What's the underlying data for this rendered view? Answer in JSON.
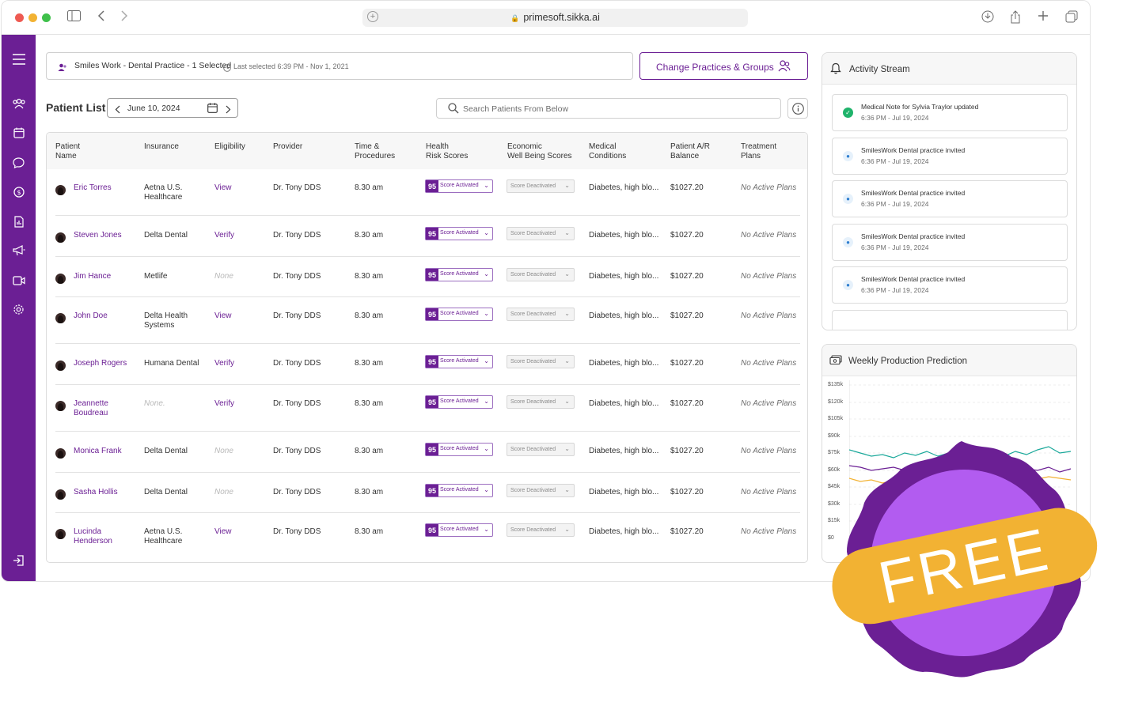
{
  "browser": {
    "url": "primesoft.sikka.ai"
  },
  "practice": {
    "name": "Smiles Work - Dental Practice - 1 Selected",
    "last_selected": "Last selected 6:39 PM - Nov 1, 2021",
    "change_button": "Change Practices & Groups"
  },
  "patient_list": {
    "title": "Patient List",
    "date": "June 10, 2024",
    "search_placeholder": "Search Patients From Below"
  },
  "table": {
    "headers": [
      {
        "line1": "Patient",
        "line2": "Name"
      },
      {
        "line1": "Insurance",
        "line2": ""
      },
      {
        "line1": "Eligibility",
        "line2": ""
      },
      {
        "line1": "Provider",
        "line2": ""
      },
      {
        "line1": "Time &",
        "line2": "Procedures"
      },
      {
        "line1": "Health",
        "line2": "Risk Scores"
      },
      {
        "line1": "Economic",
        "line2": "Well Being Scores"
      },
      {
        "line1": "Medical",
        "line2": "Conditions"
      },
      {
        "line1": "Patient A/R",
        "line2": "Balance"
      },
      {
        "line1": "Treatment",
        "line2": "Plans"
      }
    ],
    "rows": [
      {
        "name1": "Eric Torres",
        "name2": "",
        "ins1": "Aetna U.S.",
        "ins2": "Healthcare",
        "elig": "View",
        "provider": "Dr. Tony DDS",
        "time": "8.30 am",
        "score": "95",
        "score_label": "Score Activated",
        "econ": "Score Deactivated",
        "cond": "Diabetes, high blo...",
        "balance": "$1027.20",
        "plans": "No Active Plans"
      },
      {
        "name1": "Steven Jones",
        "name2": "",
        "ins1": "Delta Dental",
        "ins2": "",
        "elig": "Verify",
        "provider": "Dr. Tony DDS",
        "time": "8.30 am",
        "score": "95",
        "score_label": "Score Activated",
        "econ": "Score Deactivated",
        "cond": "Diabetes, high blo...",
        "balance": "$1027.20",
        "plans": "No Active Plans"
      },
      {
        "name1": "Jim Hance",
        "name2": "",
        "ins1": "Metlife",
        "ins2": "",
        "elig": "None",
        "provider": "Dr. Tony DDS",
        "time": "8.30 am",
        "score": "95",
        "score_label": "Score Activated",
        "econ": "Score Deactivated",
        "cond": "Diabetes, high blo...",
        "balance": "$1027.20",
        "plans": "No Active Plans"
      },
      {
        "name1": "John Doe",
        "name2": "",
        "ins1": "Delta Health",
        "ins2": "Systems",
        "elig": "View",
        "provider": "Dr. Tony DDS",
        "time": "8.30 am",
        "score": "95",
        "score_label": "Score Activated",
        "econ": "Score Deactivated",
        "cond": "Diabetes, high blo...",
        "balance": "$1027.20",
        "plans": "No Active Plans"
      },
      {
        "name1": "Joseph Rogers",
        "name2": "",
        "ins1": "Humana Dental",
        "ins2": "",
        "elig": "Verify",
        "provider": "Dr. Tony DDS",
        "time": "8.30 am",
        "score": "95",
        "score_label": "Score Activated",
        "econ": "Score Deactivated",
        "cond": "Diabetes, high blo...",
        "balance": "$1027.20",
        "plans": "No Active Plans"
      },
      {
        "name1": "Jeannette",
        "name2": "Boudreau",
        "ins1": "None.",
        "ins2": "",
        "elig": "Verify",
        "provider": "Dr. Tony DDS",
        "time": "8.30 am",
        "score": "95",
        "score_label": "Score Activated",
        "econ": "Score Deactivated",
        "cond": "Diabetes, high blo...",
        "balance": "$1027.20",
        "plans": "No Active Plans"
      },
      {
        "name1": "Monica Frank",
        "name2": "",
        "ins1": "Delta Dental",
        "ins2": "",
        "elig": "None",
        "provider": "Dr. Tony DDS",
        "time": "8.30 am",
        "score": "95",
        "score_label": "Score Activated",
        "econ": "Score Deactivated",
        "cond": "Diabetes, high blo...",
        "balance": "$1027.20",
        "plans": "No Active Plans"
      },
      {
        "name1": "Sasha Hollis",
        "name2": "",
        "ins1": "Delta Dental",
        "ins2": "",
        "elig": "None",
        "provider": "Dr. Tony DDS",
        "time": "8.30 am",
        "score": "95",
        "score_label": "Score Activated",
        "econ": "Score Deactivated",
        "cond": "Diabetes, high blo...",
        "balance": "$1027.20",
        "plans": "No Active Plans"
      },
      {
        "name1": "Lucinda",
        "name2": "Henderson",
        "ins1": "Aetna U.S.",
        "ins2": "Healthcare",
        "elig": "View",
        "provider": "Dr. Tony DDS",
        "time": "8.30 am",
        "score": "95",
        "score_label": "Score Activated",
        "econ": "Score Deactivated",
        "cond": "Diabetes, high blo...",
        "balance": "$1027.20",
        "plans": "No Active Plans"
      }
    ]
  },
  "activity": {
    "title": "Activity Stream",
    "items": [
      {
        "type": "check",
        "text": "Medical Note for Sylvia Traylor updated",
        "time": "6:36 PM - Jul 19, 2024"
      },
      {
        "type": "user",
        "text": "SmilesWork Dental practice invited",
        "time": "6:36 PM - Jul 19, 2024"
      },
      {
        "type": "user",
        "text": "SmilesWork Dental practice invited",
        "time": "6:36 PM - Jul 19, 2024"
      },
      {
        "type": "user",
        "text": "SmilesWork Dental practice invited",
        "time": "6:36 PM - Jul 19, 2024"
      },
      {
        "type": "user",
        "text": "SmilesWork Dental practice invited",
        "time": "6:36 PM - Jul 19, 2024"
      }
    ]
  },
  "weekly": {
    "title": "Weekly Production Prediction",
    "y_ticks": [
      "$135k",
      "$120k",
      "$105k",
      "$90k",
      "$75k",
      "$60k",
      "$45k",
      "$30k",
      "$15k",
      "$0"
    ],
    "colors": {
      "teal": "#1aa89a",
      "purple": "#6b1f94",
      "yellow": "#f2b233"
    }
  },
  "badge": {
    "text": "FREE",
    "colors": {
      "outer": "#6b1f94",
      "inner": "#b25cf0",
      "ribbon": "#f2b233"
    }
  },
  "theme": {
    "accent": "#6b1f94"
  }
}
